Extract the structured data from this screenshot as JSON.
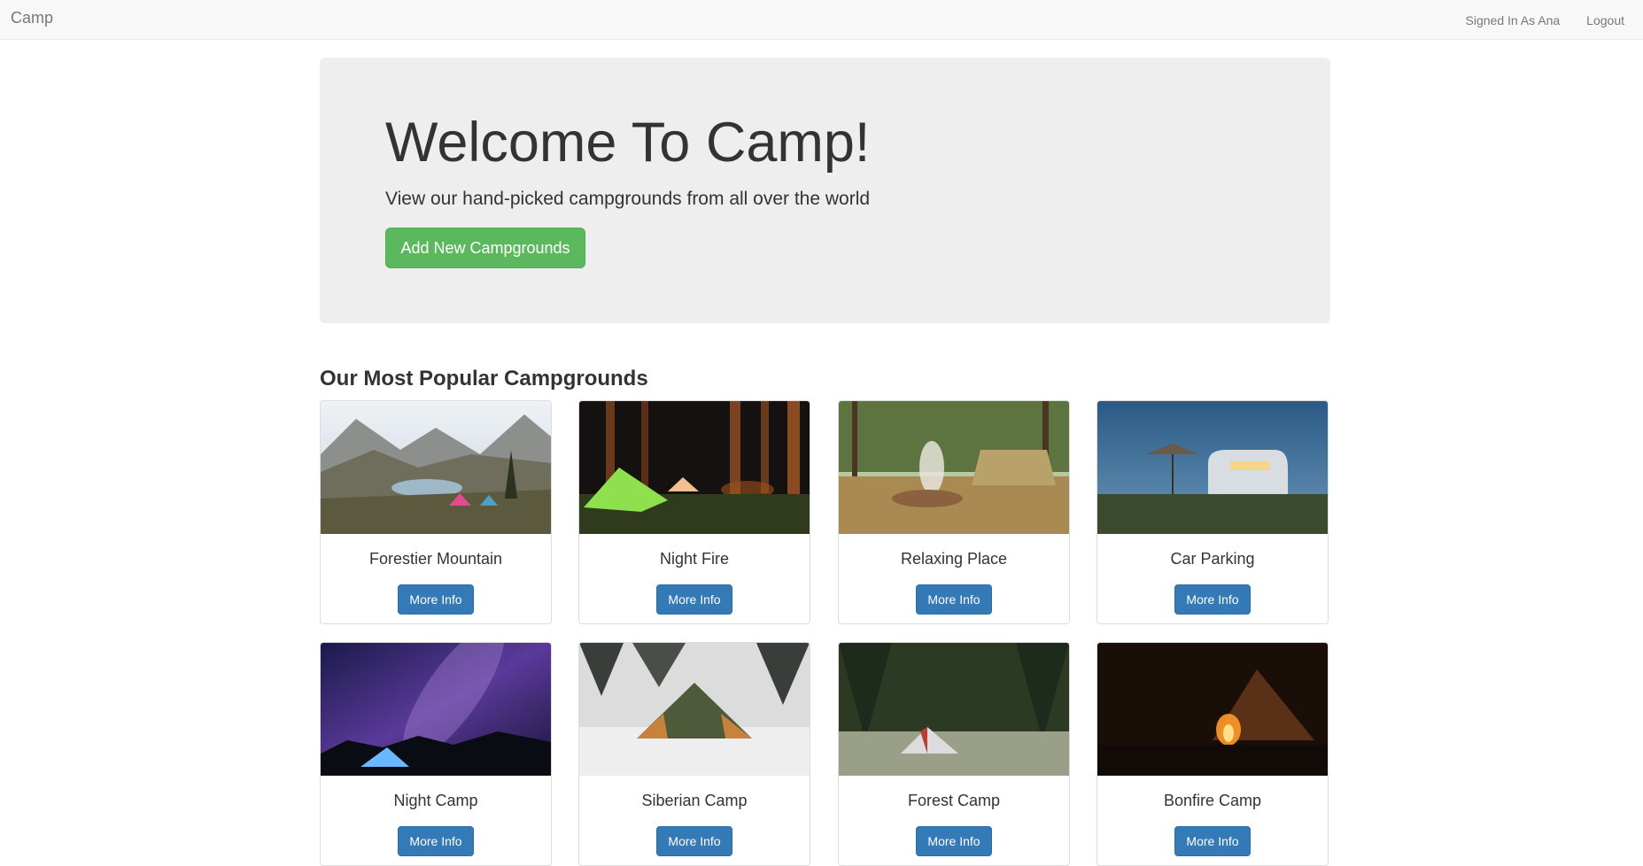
{
  "navbar": {
    "brand": "Camp",
    "signed_in": "Signed In As Ana",
    "logout": "Logout"
  },
  "hero": {
    "title": "Welcome To Camp!",
    "subtitle": "View our hand-picked campgrounds from all over the world",
    "add_button": "Add New Campgrounds"
  },
  "section": {
    "title": "Our Most Popular Campgrounds"
  },
  "colors": {
    "success": "#5cb85c",
    "primary": "#337ab7"
  },
  "campgrounds": [
    {
      "name": "Forestier Mountain",
      "button": "More Info"
    },
    {
      "name": "Night Fire",
      "button": "More Info"
    },
    {
      "name": "Relaxing Place",
      "button": "More Info"
    },
    {
      "name": "Car Parking",
      "button": "More Info"
    },
    {
      "name": "Night Camp",
      "button": "More Info"
    },
    {
      "name": "Siberian Camp",
      "button": "More Info"
    },
    {
      "name": "Forest Camp",
      "button": "More Info"
    },
    {
      "name": "Bonfire Camp",
      "button": "More Info"
    }
  ]
}
